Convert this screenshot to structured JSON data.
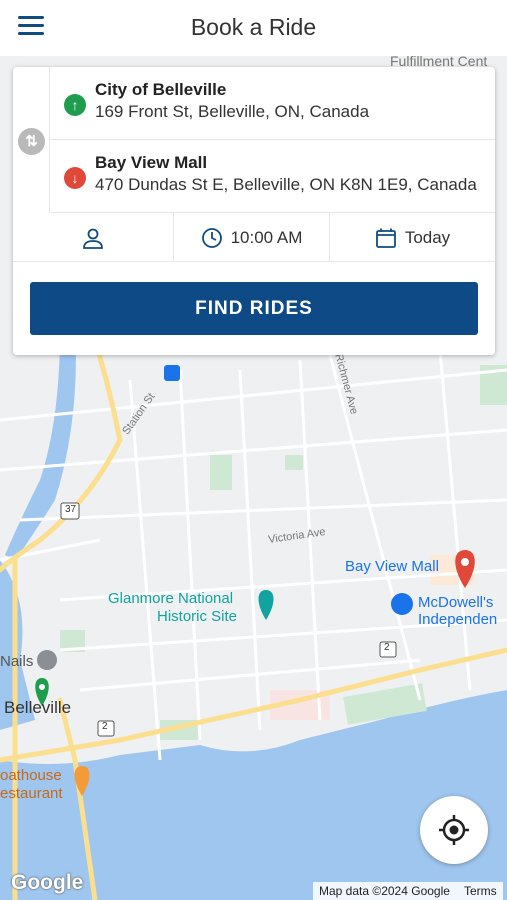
{
  "header": {
    "title": "Book a Ride",
    "menu_icon": "menu-icon"
  },
  "trip": {
    "origin": {
      "name": "City of Belleville",
      "address": "169 Front St, Belleville, ON, Canada",
      "color": "#1e9e4c"
    },
    "destination": {
      "name": "Bay View Mall",
      "address": "470 Dundas St E, Belleville, ON K8N 1E9, Canada",
      "color": "#e0483a"
    }
  },
  "options": {
    "time": "10:00 AM",
    "date": "Today"
  },
  "find_button": {
    "label": "FIND RIDES",
    "color": "#0d4a86"
  },
  "map": {
    "labels": {
      "fulfillment": "Fulfillment Cent",
      "station_st": "Station St",
      "richmer_ave": "Richmer Ave",
      "victoria_ave": "Victoria Ave",
      "bay_view_mall": "Bay View Mall",
      "glanmore": "Glanmore National",
      "historic_site": "Historic Site",
      "mcdowells_1": "McDowell's",
      "mcdowells_2": "Independen",
      "nails": "Nails",
      "belleville": "Belleville",
      "boathouse_1": "oathouse",
      "boathouse_2": "estaurant",
      "route_37": "37",
      "route_2a": "2",
      "route_2b": "2"
    },
    "attribution": "Map data ©2024 Google",
    "terms": "Terms",
    "google_logo": "Google"
  }
}
